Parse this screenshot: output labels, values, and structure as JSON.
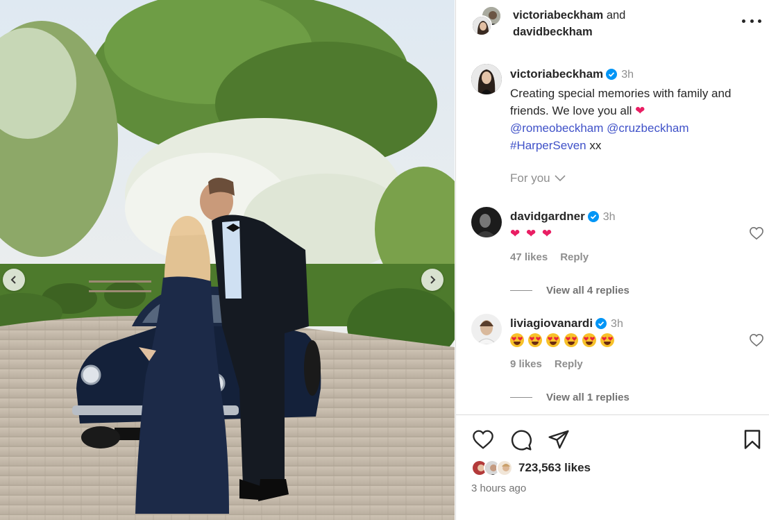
{
  "post": {
    "header": {
      "user1": "victoriabeckham",
      "and": "and",
      "user2": "davidbeckham"
    },
    "caption": {
      "username": "victoriabeckham",
      "time": "3h",
      "text": "Creating special memories with family and friends. We love you all",
      "mention1": "@romeobeckham",
      "mention2": "@cruzbeckham",
      "hashtag": "#HarperSeven",
      "suffix": "xx"
    },
    "for_you_label": "For you",
    "comments": [
      {
        "username": "davidgardner",
        "time": "3h",
        "likes": "47 likes",
        "reply": "Reply",
        "view_replies": "View all 4 replies"
      },
      {
        "username": "liviagiovanardi",
        "time": "3h",
        "likes": "9 likes",
        "reply": "Reply",
        "view_replies": "View all 1 replies"
      }
    ],
    "likes_count": "723,563 likes",
    "posted_ago": "3 hours ago"
  },
  "icons": [
    "heart-icon",
    "comment-icon",
    "share-icon",
    "save-icon",
    "more-icon",
    "verified-icon",
    "chevron-down-icon",
    "chevron-left-icon",
    "chevron-right-icon"
  ],
  "colors": {
    "verified": "#0095f6",
    "mention": "#3f51c8",
    "heart": "#e91e63",
    "muted": "#8e8e8e"
  }
}
